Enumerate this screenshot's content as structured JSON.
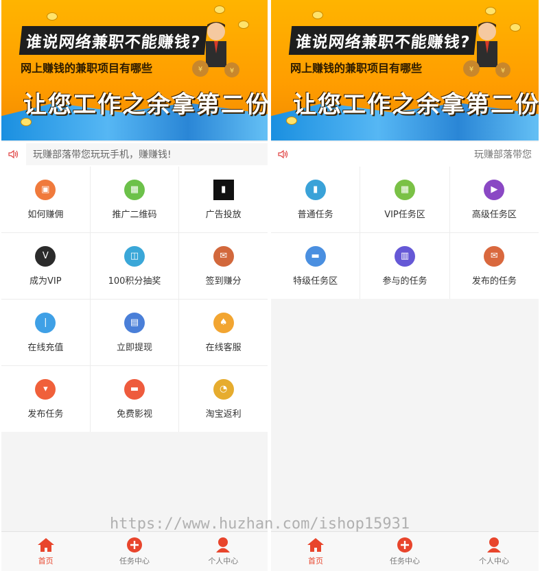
{
  "banner": {
    "line1": "谁说网络兼职不能赚钱?",
    "line2": "网上赚钱的兼职项目有哪些",
    "line3": "让您工作之余拿第二份收入"
  },
  "left": {
    "notice": "玩赚部落带您玩玩手机，赚赚钱!",
    "items": [
      {
        "label": "如何赚佣",
        "color": "#f07a3c",
        "icon": "wallet-icon"
      },
      {
        "label": "推广二维码",
        "color": "#6cc14a",
        "icon": "qrcode-icon"
      },
      {
        "label": "广告投放",
        "color": "#111111",
        "icon": "ad-image-icon"
      },
      {
        "label": "成为VIP",
        "color": "#2b2b2b",
        "icon": "vip-icon"
      },
      {
        "label": "100积分抽奖",
        "color": "#3aa7d8",
        "icon": "lottery-icon"
      },
      {
        "label": "签到赚分",
        "color": "#d2683c",
        "icon": "checkin-icon"
      },
      {
        "label": "在线充值",
        "color": "#3fa0e6",
        "icon": "thermometer-icon"
      },
      {
        "label": "立即提现",
        "color": "#4a7fd8",
        "icon": "withdraw-icon"
      },
      {
        "label": "在线客服",
        "color": "#f2a531",
        "icon": "service-icon"
      },
      {
        "label": "发布任务",
        "color": "#f0603a",
        "icon": "cart-icon"
      },
      {
        "label": "免费影视",
        "color": "#ee5b3d",
        "icon": "video-icon"
      },
      {
        "label": "淘宝返利",
        "color": "#e6ac2e",
        "icon": "headset-icon"
      }
    ]
  },
  "right": {
    "notice": "玩赚部落带您",
    "items": [
      {
        "label": "普通任务",
        "color": "#3aa2d8",
        "icon": "task-icon"
      },
      {
        "label": "VIP任务区",
        "color": "#7ac146",
        "icon": "grid-icon"
      },
      {
        "label": "高级任务区",
        "color": "#8a48c4",
        "icon": "play-icon"
      },
      {
        "label": "特级任务区",
        "color": "#4a8fe0",
        "icon": "store-icon"
      },
      {
        "label": "参与的任务",
        "color": "#6558d6",
        "icon": "gift-icon"
      },
      {
        "label": "发布的任务",
        "color": "#d9683e",
        "icon": "mail-icon"
      }
    ]
  },
  "tabs": [
    {
      "label": "首页",
      "icon": "home-icon",
      "active": true
    },
    {
      "label": "任务中心",
      "icon": "plus-circle-icon",
      "active": false
    },
    {
      "label": "个人中心",
      "icon": "user-icon",
      "active": false
    }
  ],
  "watermark": "https://www.huzhan.com/ishop15931",
  "colors": {
    "accent": "#e8452c",
    "banner": "#ffa800"
  }
}
